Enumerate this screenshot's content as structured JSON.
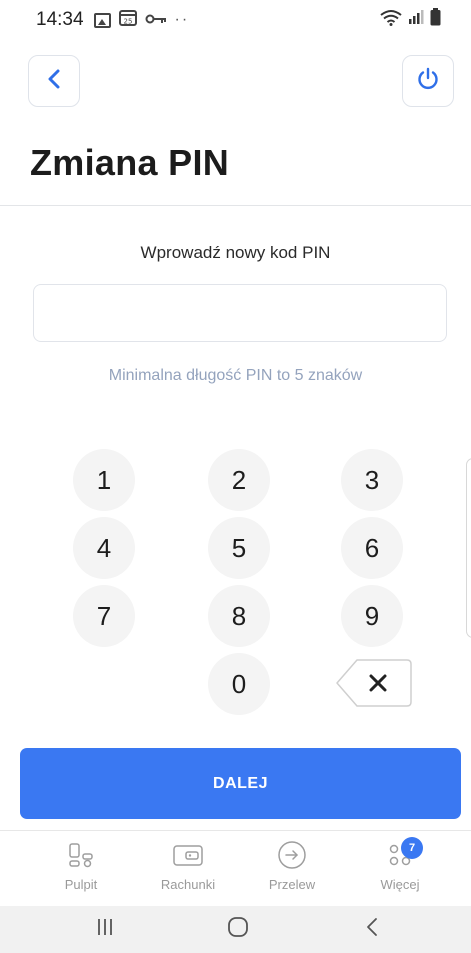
{
  "status_bar": {
    "time": "14:34",
    "dots": "··",
    "icons": [
      "gallery-icon",
      "calendar-icon",
      "key-icon",
      "wifi-icon",
      "signal-icon",
      "battery-icon"
    ]
  },
  "header": {
    "back_icon": "chevron-left-icon",
    "power_icon": "power-icon",
    "title": "Zmiana PIN"
  },
  "form": {
    "prompt": "Wprowadź nowy kod PIN",
    "pin_value": "",
    "hint": "Minimalna długość PIN to 5 znaków"
  },
  "keypad": {
    "keys": [
      "1",
      "2",
      "3",
      "4",
      "5",
      "6",
      "7",
      "8",
      "9",
      "0"
    ],
    "delete_icon": "backspace-icon"
  },
  "actions": {
    "next_label": "DALEJ"
  },
  "bottom_nav": {
    "items": [
      {
        "label": "Pulpit",
        "icon": "dashboard-icon"
      },
      {
        "label": "Rachunki",
        "icon": "wallet-icon"
      },
      {
        "label": "Przelew",
        "icon": "transfer-icon"
      },
      {
        "label": "Więcej",
        "icon": "more-icon",
        "badge": "7"
      }
    ]
  },
  "colors": {
    "accent": "#3a78f2",
    "hint": "#94a3bd",
    "key_bg": "#f4f4f4"
  }
}
